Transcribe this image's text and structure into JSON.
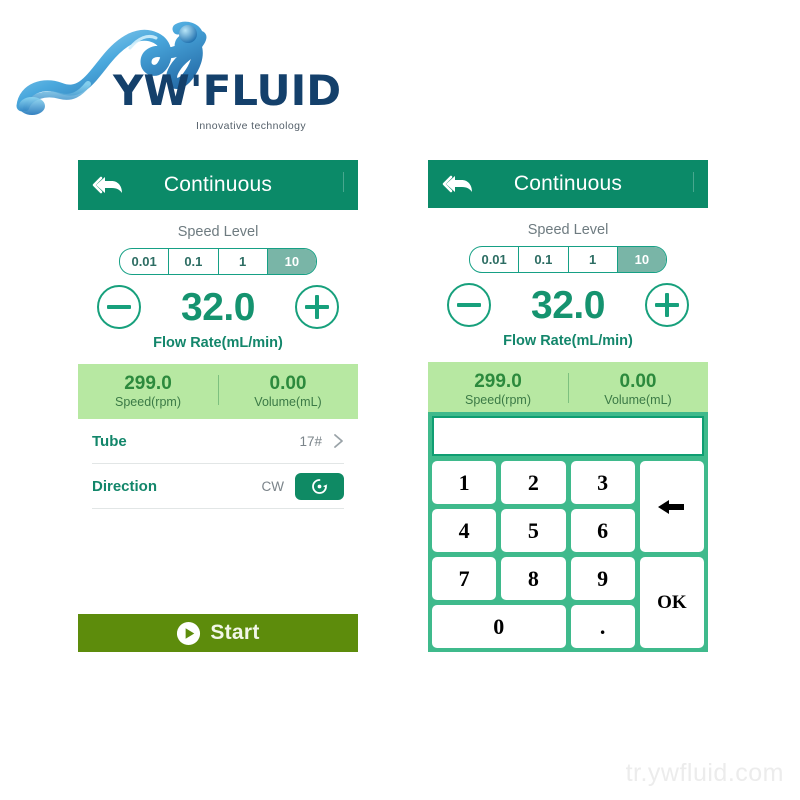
{
  "brand": {
    "wordmark": "YW'FLUID",
    "tagline": "Innovative technology",
    "logo_blue_dark": "#1a5f9e",
    "logo_blue_light": "#7fd4f0",
    "wordmark_color": "#14406b"
  },
  "watermark": "tr.ywfluid.com",
  "theme": {
    "header_green": "#0b8a68",
    "accent_green": "#17a07c",
    "readout_bg": "#b7e8a2",
    "readout_text": "#2c8a3d",
    "start_olive": "#5d8c0c",
    "keypad_green": "#3fba8c",
    "segment_active": "#79b5a7"
  },
  "panel_left": {
    "header": {
      "title": "Continuous",
      "back_icon": "double-back-arrow-icon"
    },
    "speed_level": {
      "label": "Speed Level",
      "options": [
        "0.01",
        "0.1",
        "1",
        "10"
      ],
      "selected": "10"
    },
    "flow": {
      "minus_icon": "minus-circle-icon",
      "plus_icon": "plus-circle-icon",
      "value": "32.0",
      "caption": "Flow Rate(mL/min)"
    },
    "readout": [
      {
        "value": "299.0",
        "label": "Speed(rpm)"
      },
      {
        "value": "0.00",
        "label": "Volume(mL)"
      }
    ],
    "rows": [
      {
        "label": "Tube",
        "value": "17#",
        "icon": "chevron-right-icon"
      },
      {
        "label": "Direction",
        "value": "CW",
        "icon": "rotate-cw-icon"
      }
    ],
    "start": {
      "label": "Start",
      "icon": "play-circle-icon"
    }
  },
  "panel_right": {
    "header": {
      "title": "Continuous",
      "back_icon": "double-back-arrow-icon"
    },
    "speed_level": {
      "label": "Speed Level",
      "options": [
        "0.01",
        "0.1",
        "1",
        "10"
      ],
      "selected": "10"
    },
    "flow": {
      "value": "32.0",
      "caption": "Flow Rate(mL/min)"
    },
    "readout": [
      {
        "value": "299.0",
        "label": "Speed(rpm)"
      },
      {
        "value": "0.00",
        "label": "Volume(mL)"
      }
    ],
    "keypad": {
      "display_value": "",
      "keys": [
        "1",
        "2",
        "3",
        "4",
        "5",
        "6",
        "7",
        "8",
        "9"
      ],
      "zero": "0",
      "dot": ".",
      "backspace_icon": "backspace-arrow-icon",
      "ok": "OK"
    }
  }
}
